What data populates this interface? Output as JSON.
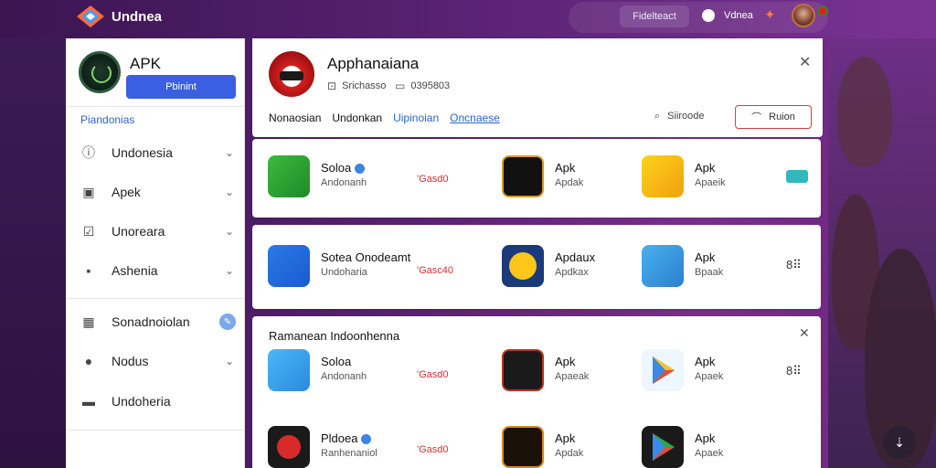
{
  "topbar": {
    "brand": "Undnea",
    "action_button": "Fidelteact",
    "user_label": "Vdnea"
  },
  "sidebar": {
    "profile_title": "APK",
    "profile_button": "Pbinint",
    "section_label": "Piandonias",
    "items": [
      {
        "label": "Undonesia",
        "icon": "info-icon"
      },
      {
        "label": "Apek",
        "icon": "bag-icon"
      },
      {
        "label": "Unoreara",
        "icon": "checklist-icon"
      },
      {
        "label": "Ashenia",
        "icon": "box-icon"
      },
      {
        "label": "Sonadnoiolan",
        "icon": "calendar-icon"
      },
      {
        "label": "Nodus",
        "icon": "person-icon"
      },
      {
        "label": "Undoheria",
        "icon": "card-icon"
      }
    ]
  },
  "app_header": {
    "title": "Apphanaiana",
    "meta1": "Srichasso",
    "meta2": "0395803",
    "tabs": [
      "Nonaosian",
      "Undonkan",
      "Uipinoian",
      "Oncnaese"
    ],
    "search_label": "Siiroode",
    "action_label": "Ruion"
  },
  "row1": {
    "apps": [
      {
        "name": "Soloa",
        "sub": "Andonanh"
      },
      {
        "name": "Apk",
        "sub": "Apdak"
      },
      {
        "name": "Apk",
        "sub": "Apaeik"
      }
    ],
    "price": "'Gasd0"
  },
  "row2": {
    "apps": [
      {
        "name": "Sotea  Onodeamt",
        "sub": "Undoharia"
      },
      {
        "name": "Apdaux",
        "sub": "Apdkax"
      },
      {
        "name": "Apk",
        "sub": "Bpaak"
      }
    ],
    "price": "'Gasc40",
    "tail": "8⠿"
  },
  "section2": {
    "title": "Ramanean Indoonhenna",
    "apps": [
      {
        "name": "Soloa",
        "sub": "Andonanh"
      },
      {
        "name": "Apk",
        "sub": "Apaeak"
      },
      {
        "name": "Apk",
        "sub": "Apaek"
      },
      {
        "name": "Pldoea",
        "sub": "Ranhenaniol"
      },
      {
        "name": "Apk",
        "sub": "Apdak"
      },
      {
        "name": "Apk",
        "sub": "Apaek"
      }
    ],
    "price1": "'Gasd0",
    "price2": "'Gasd0",
    "tail": "8⠿"
  }
}
